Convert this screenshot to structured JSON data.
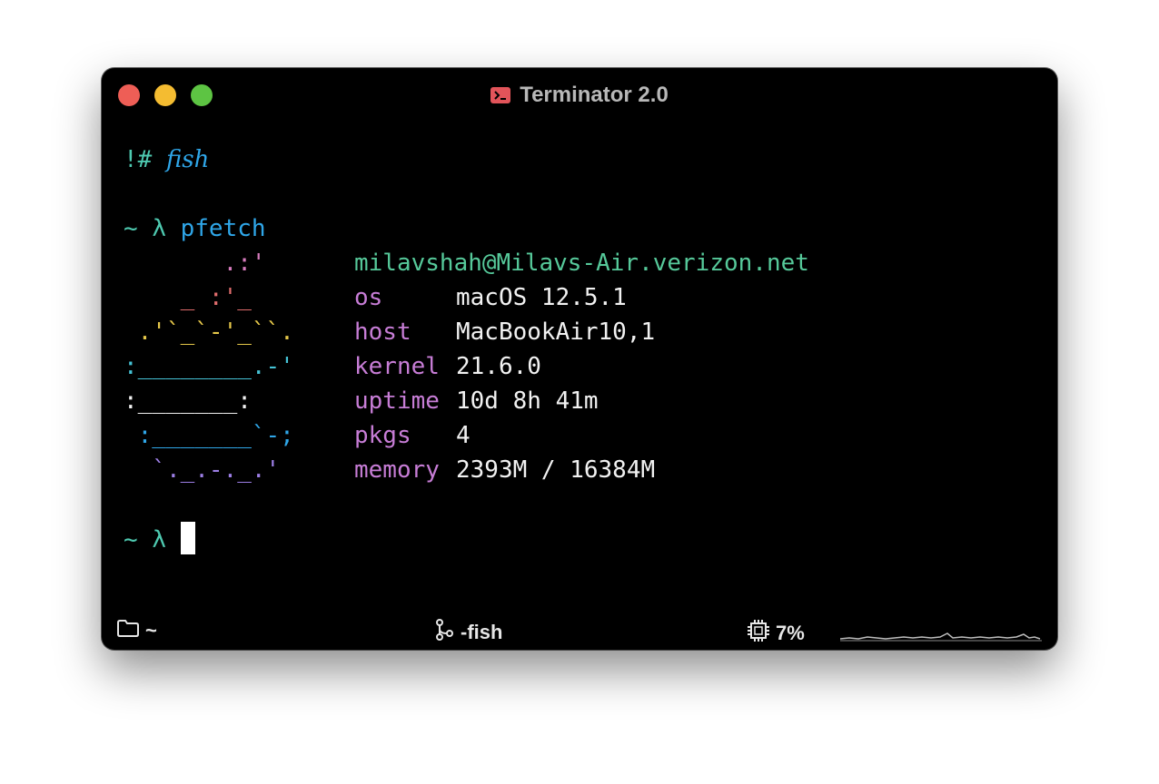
{
  "window": {
    "title": "Terminator 2.0",
    "colors": {
      "close": "#ee5e56",
      "minimize": "#f4bc31",
      "maximize": "#5dc443",
      "icon": "#e2545a"
    }
  },
  "terminal": {
    "shebang": {
      "prefix": "!#",
      "shell": "fish"
    },
    "prompt": {
      "tilde": "~",
      "lambda": "λ"
    },
    "command": "pfetch",
    "ascii_art": [
      "       .:'",
      "    _ :'_",
      " .'`_`-'_``.",
      ":________.-'",
      ":_______:",
      " :_______`-;",
      "  `._.-._.'"
    ],
    "user_host": "milavshah@Milavs-Air.verizon.net",
    "info": [
      {
        "key": "os",
        "value": "macOS 12.5.1"
      },
      {
        "key": "host",
        "value": "MacBookAir10,1"
      },
      {
        "key": "kernel",
        "value": "21.6.0"
      },
      {
        "key": "uptime",
        "value": "10d 8h 41m"
      },
      {
        "key": "pkgs",
        "value": "4"
      },
      {
        "key": "memory",
        "value": "2393M / 16384M"
      }
    ]
  },
  "statusbar": {
    "cwd": "~",
    "process": "-fish",
    "cpu": "7%"
  }
}
